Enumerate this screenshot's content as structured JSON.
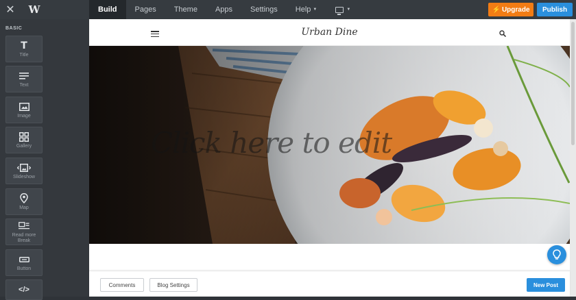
{
  "colors": {
    "accent": "#2a8fdd",
    "upgrade": "#f27c14",
    "topbar": "#363b40",
    "sidebar": "#34383d"
  },
  "topbar": {
    "close_icon": "close-icon",
    "logo": "W",
    "tabs": [
      {
        "label": "Build",
        "active": true
      },
      {
        "label": "Pages"
      },
      {
        "label": "Theme"
      },
      {
        "label": "Apps"
      },
      {
        "label": "Settings"
      },
      {
        "label": "Help"
      }
    ],
    "device_icon": "monitor-icon",
    "upgrade_label": "Upgrade",
    "publish_label": "Publish"
  },
  "sidebar": {
    "section": "BASIC",
    "items": [
      {
        "label": "Title",
        "icon": "title-icon"
      },
      {
        "label": "Text",
        "icon": "text-icon"
      },
      {
        "label": "Image",
        "icon": "image-icon"
      },
      {
        "label": "Gallery",
        "icon": "gallery-icon"
      },
      {
        "label": "Slideshow",
        "icon": "slideshow-icon"
      },
      {
        "label": "Map",
        "icon": "map-pin-icon"
      },
      {
        "label": "Read more Break",
        "icon": "read-more-icon"
      },
      {
        "label": "Button",
        "icon": "button-icon"
      },
      {
        "label": "",
        "icon": "code-icon"
      }
    ]
  },
  "site": {
    "brand": "Urban Dine",
    "hero_title": "Click here to edit"
  },
  "footer": {
    "comments_label": "Comments",
    "blog_settings_label": "Blog Settings",
    "new_post_label": "New Post"
  }
}
